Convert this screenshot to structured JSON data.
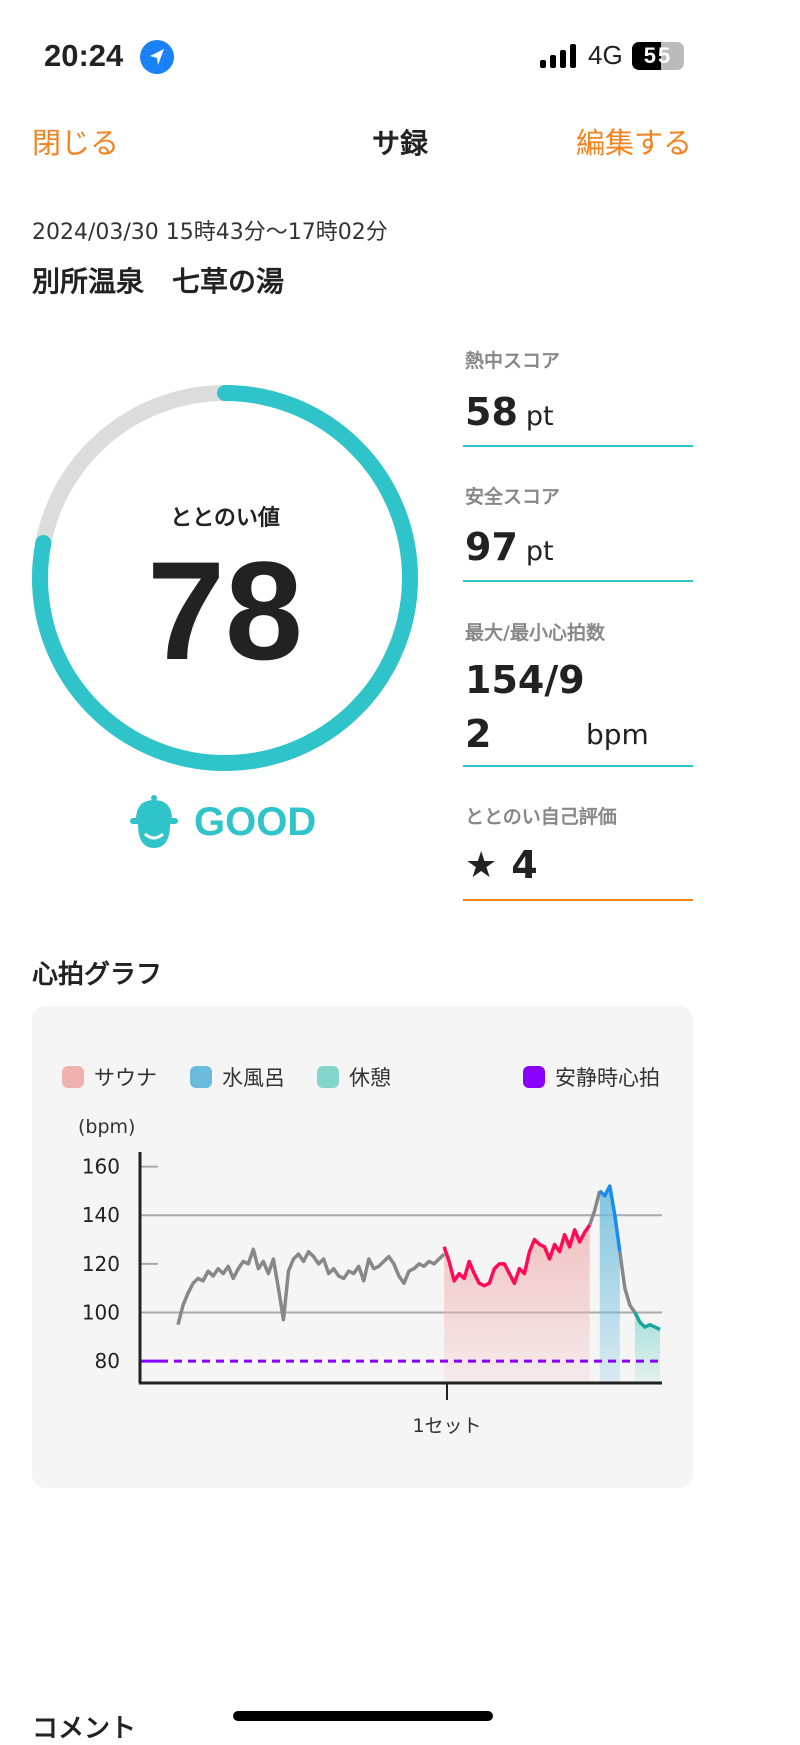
{
  "status_bar": {
    "time": "20:24",
    "network": "4G",
    "battery": "55",
    "battery_level_percent": 55,
    "location_icon": "location-arrow-icon"
  },
  "nav": {
    "close": "閉じる",
    "title": "サ録",
    "edit": "編集する"
  },
  "session": {
    "datetime": "2024/03/30 15時43分〜17時02分",
    "place": "別所温泉　七草の湯"
  },
  "score": {
    "label": "ととのい値",
    "value": "78",
    "level_percent": 78,
    "rating": "GOOD",
    "icon": "smiling-face-hat-icon"
  },
  "stats": [
    {
      "label": "熱中スコア",
      "value": "58",
      "unit": "pt"
    },
    {
      "label": "安全スコア",
      "value": "97",
      "unit": "pt"
    },
    {
      "label": "最大/最小心拍数",
      "value": "154/9",
      "value2": "2",
      "unit": "bpm"
    },
    {
      "label": "ととのい自己評価",
      "value": "4",
      "icon": "star-icon"
    }
  ],
  "colors": {
    "accent": "#2ec4c9",
    "orange": "#f5821f",
    "sauna": "#ff0a55",
    "cold": "#1a8cf0",
    "rest": "#1aa6a0",
    "resting": "#8a00ff"
  },
  "heart_graph": {
    "title": "心拍グラフ"
  },
  "chart_data": {
    "type": "line",
    "ylabel": "(bpm)",
    "ylim": [
      71,
      166
    ],
    "yticks": [
      160,
      140,
      120,
      100,
      80
    ],
    "xticks": [
      "1セット"
    ],
    "legend": [
      {
        "name": "サウナ",
        "color": "#f0b1b1"
      },
      {
        "name": "水風呂",
        "color": "#6bbcdc"
      },
      {
        "name": "休憩",
        "color": "#84d6cc"
      },
      {
        "name": "安静時心拍",
        "color": "#8a00ff"
      }
    ],
    "resting_hr": 80,
    "segments": [
      {
        "phase": "other",
        "values": [
          95,
          103,
          108,
          112,
          114,
          113,
          117,
          115,
          118,
          116,
          119,
          114,
          118,
          121,
          120,
          126,
          118,
          121,
          116,
          122,
          110,
          97,
          117,
          122,
          124,
          121,
          125,
          123,
          120,
          122,
          116,
          118,
          115,
          114,
          117,
          116,
          119,
          113,
          122,
          118,
          119,
          121,
          123,
          120,
          115,
          112,
          117,
          118,
          120,
          119,
          121,
          120,
          122,
          124
        ]
      },
      {
        "phase": "sauna",
        "values": [
          127,
          121,
          113,
          116,
          114,
          121,
          116,
          112,
          111,
          112,
          118,
          120,
          120,
          116,
          112,
          118,
          116,
          125,
          130,
          128,
          127,
          122,
          128,
          125,
          132,
          127,
          134,
          129,
          133,
          136
        ]
      },
      {
        "phase": "other",
        "values": [
          136,
          142,
          150
        ]
      },
      {
        "phase": "cold",
        "values": [
          150,
          148,
          152,
          140,
          125
        ]
      },
      {
        "phase": "other",
        "values": [
          125,
          110,
          103,
          100
        ]
      },
      {
        "phase": "rest",
        "values": [
          100,
          96,
          94,
          95,
          94,
          93
        ]
      }
    ]
  },
  "comment": {
    "title": "コメント"
  }
}
